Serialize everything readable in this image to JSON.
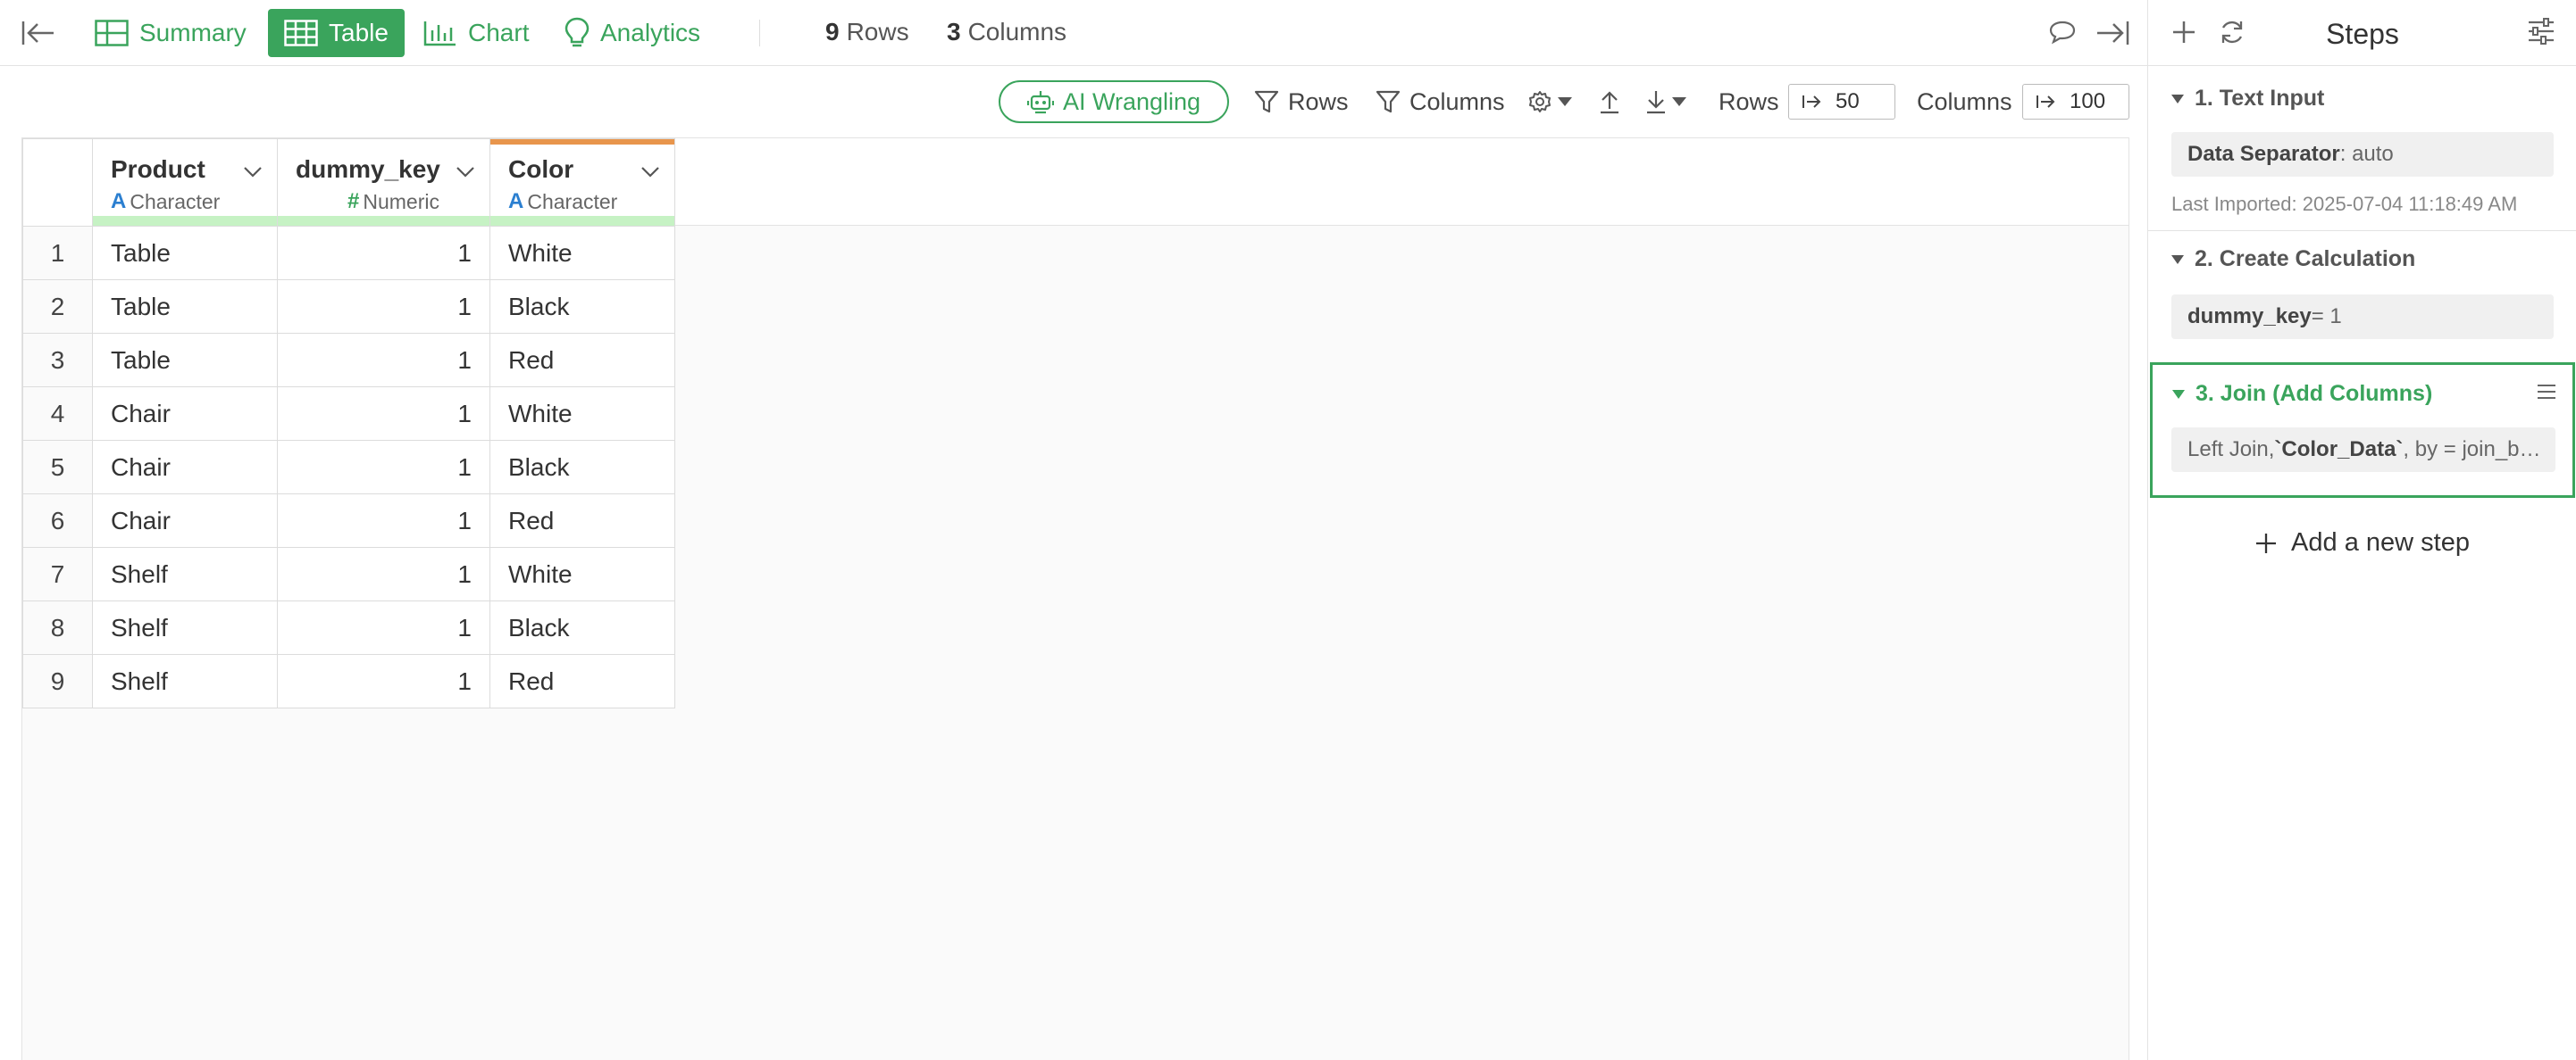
{
  "nav": {
    "summary": "Summary",
    "table": "Table",
    "chart": "Chart",
    "analytics": "Analytics"
  },
  "counts": {
    "rows_num": "9",
    "rows_label": "Rows",
    "cols_num": "3",
    "cols_label": "Columns"
  },
  "toolbar": {
    "ai_wrangling": "AI Wrangling",
    "rows_filter": "Rows",
    "columns_filter": "Columns",
    "rows_label": "Rows",
    "rows_value": "50",
    "columns_label": "Columns",
    "columns_value": "100"
  },
  "table": {
    "columns": [
      {
        "name": "Product",
        "type": "Character"
      },
      {
        "name": "dummy_key",
        "type": "Numeric"
      },
      {
        "name": "Color",
        "type": "Character"
      }
    ],
    "rows": [
      {
        "n": "1",
        "product": "Table",
        "key": "1",
        "color": "White"
      },
      {
        "n": "2",
        "product": "Table",
        "key": "1",
        "color": "Black"
      },
      {
        "n": "3",
        "product": "Table",
        "key": "1",
        "color": "Red"
      },
      {
        "n": "4",
        "product": "Chair",
        "key": "1",
        "color": "White"
      },
      {
        "n": "5",
        "product": "Chair",
        "key": "1",
        "color": "Black"
      },
      {
        "n": "6",
        "product": "Chair",
        "key": "1",
        "color": "Red"
      },
      {
        "n": "7",
        "product": "Shelf",
        "key": "1",
        "color": "White"
      },
      {
        "n": "8",
        "product": "Shelf",
        "key": "1",
        "color": "Black"
      },
      {
        "n": "9",
        "product": "Shelf",
        "key": "1",
        "color": "Red"
      }
    ]
  },
  "steps": {
    "title": "Steps",
    "step1": {
      "title": "1. Text Input",
      "param": "Data Separator",
      "value": ": auto",
      "imported": "Last Imported: 2025-07-04 11:18:49 AM"
    },
    "step2": {
      "title": "2. Create Calculation",
      "param": "dummy_key",
      "value": " = 1"
    },
    "step3": {
      "title": "3. Join (Add Columns)",
      "prefix": "Left Join, ",
      "dataset": "`Color_Data`",
      "suffix": ", by = join_b…"
    },
    "add_step": "Add a new step"
  },
  "colors": {
    "accent": "#3aa45c",
    "type_character": "#2b7fd0",
    "key_bar": "#c6f2c4",
    "joined_bar": "#e8954c"
  }
}
